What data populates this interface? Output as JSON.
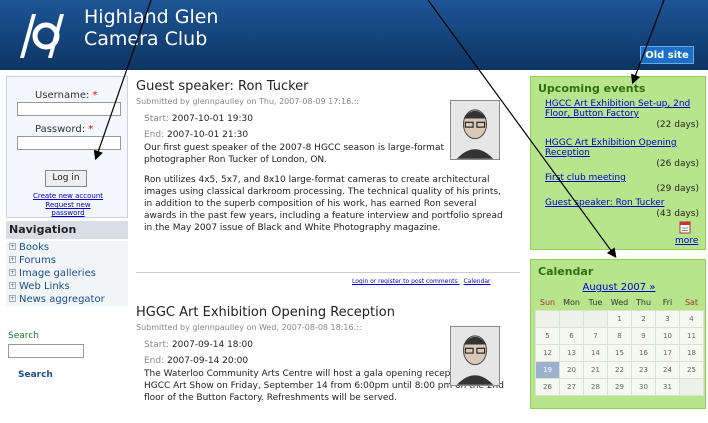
{
  "header": {
    "title_line1": "Highland Glen",
    "title_line2": "Camera Club",
    "old_site": "Old site",
    "brand_color": "#0f3f72"
  },
  "login": {
    "username_label": "Username:",
    "password_label": "Password:",
    "required_mark": "*",
    "login_button": "Log in",
    "create_account": "Create new account",
    "request_password_1": "Request new",
    "request_password_2": "password"
  },
  "navigation": {
    "title": "Navigation",
    "items": [
      {
        "label": "Books"
      },
      {
        "label": "Forums"
      },
      {
        "label": "Image galleries"
      },
      {
        "label": "Web Links"
      },
      {
        "label": "News aggregator"
      }
    ]
  },
  "search": {
    "label": "Search",
    "button": "Search"
  },
  "posts": [
    {
      "title": "Guest speaker: Ron Tucker",
      "submitted": "Submitted by glennpaulley on Thu, 2007-08-09 17:16.::",
      "start_label": "Start:",
      "start": "2007-10-01 19:30",
      "end_label": "End:",
      "end": "2007-10-01 21:30",
      "body1": "Our first guest speaker of the 2007-8 HGCC season is large-format photographer Ron Tucker of London, ON.",
      "body2": "Ron utilizes 4x5, 5x7, and 8x10 large-format cameras to create architectural images using classical darkroom processing. The technical quality of his prints, in addition to the superb composition of his work, has earned Ron several awards in the past few years, including a feature interview and portfolio spread in the May 2007 issue of Black and White Photography magazine.",
      "login_link": "Login or register to post comments",
      "calendar_link": "Calendar"
    },
    {
      "title": "HGGC Art Exhibition Opening Reception",
      "submitted": "Submitted by glennpaulley on Wed, 2007-08-08 18:16.::",
      "start_label": "Start:",
      "start": "2007-09-14 18:00",
      "end_label": "End:",
      "end": "2007-09-14 20:00",
      "body1": "The Waterloo Community Arts Centre will host a gala opening reception for the HGCC Art Show on Friday, September 14 from 6:00pm until 8:00 pm on the 2nd floor of the Button Factory. Refreshments will be served."
    }
  ],
  "events": {
    "title": "Upcoming events",
    "items": [
      {
        "label_1": "HGCC Art Exhibition Set-up, 2nd",
        "label_2": "Floor, Button Factory",
        "days": "(22 days)"
      },
      {
        "label_1": "HGGC Art Exhibition Opening",
        "label_2": "Reception",
        "days": "(26 days)"
      },
      {
        "label_1": "First club meeting",
        "label_2": "",
        "days": "(29 days)"
      },
      {
        "label_1": "Guest speaker: Ron Tucker",
        "label_2": "",
        "days": "(43 days)"
      }
    ],
    "more": "more"
  },
  "calendar": {
    "title": "Calendar",
    "month": "August 2007 »",
    "weekdays": [
      "Sun",
      "Mon",
      "Tue",
      "Wed",
      "Thu",
      "Fri",
      "Sat"
    ],
    "weeks": [
      [
        "",
        "",
        "",
        "1",
        "2",
        "3",
        "4"
      ],
      [
        "5",
        "6",
        "7",
        "8",
        "9",
        "10",
        "11"
      ],
      [
        "12",
        "13",
        "14",
        "15",
        "16",
        "17",
        "18"
      ],
      [
        "19",
        "20",
        "21",
        "22",
        "23",
        "24",
        "25"
      ],
      [
        "26",
        "27",
        "28",
        "29",
        "30",
        "31",
        ""
      ]
    ],
    "today": "19"
  }
}
